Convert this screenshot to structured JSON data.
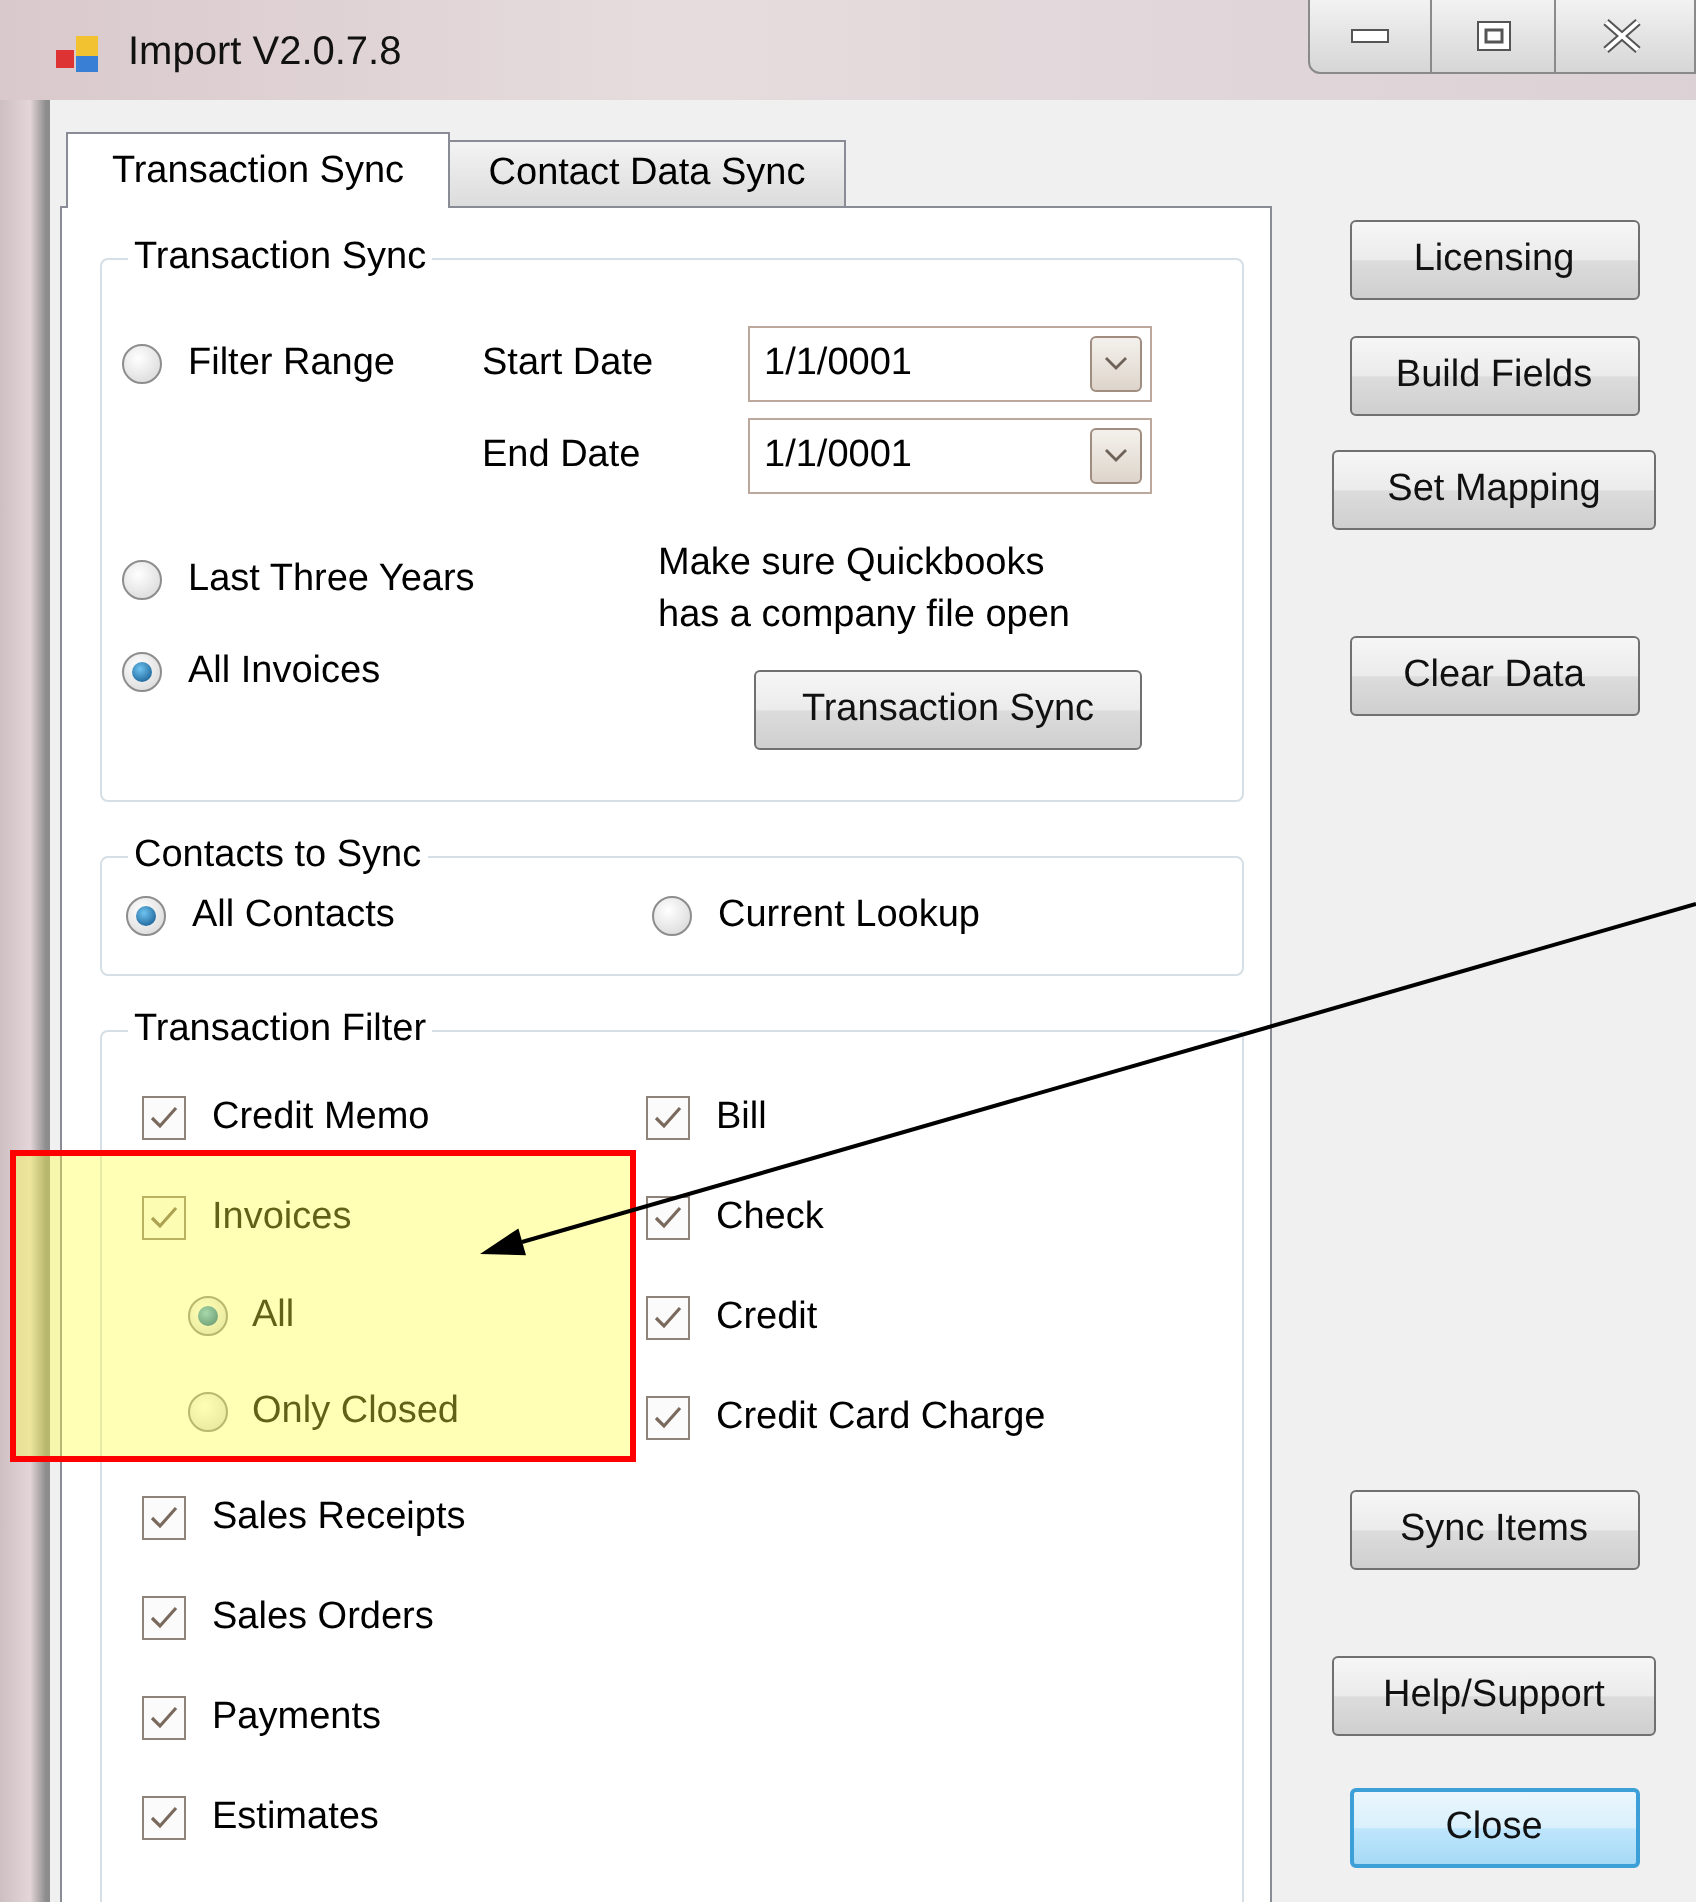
{
  "window": {
    "title": "Import V2.0.7.8"
  },
  "tabs": [
    {
      "label": "Transaction Sync",
      "selected": true
    },
    {
      "label": "Contact Data Sync",
      "selected": false
    }
  ],
  "transaction_sync": {
    "title": "Transaction Sync",
    "range_options": [
      {
        "label": "Filter Range",
        "selected": false
      },
      {
        "label": "Last Three Years",
        "selected": false
      },
      {
        "label": "All Invoices",
        "selected": true
      }
    ],
    "start_date": {
      "label": "Start Date",
      "value": "1/1/0001"
    },
    "end_date": {
      "label": "End Date",
      "value": "1/1/0001"
    },
    "note": "Make sure Quickbooks\nhas a company file open",
    "button": "Transaction Sync"
  },
  "contacts_to_sync": {
    "title": "Contacts to Sync",
    "options": [
      {
        "label": "All Contacts",
        "selected": true
      },
      {
        "label": "Current Lookup",
        "selected": false
      }
    ]
  },
  "transaction_filter": {
    "title": "Transaction Filter",
    "left": [
      {
        "label": "Credit Memo",
        "checked": true
      },
      {
        "label": "Invoices",
        "checked": true,
        "children": [
          {
            "label": "All",
            "selected": true
          },
          {
            "label": "Only Closed",
            "selected": false
          }
        ]
      },
      {
        "label": "Sales Receipts",
        "checked": true
      },
      {
        "label": "Sales Orders",
        "checked": true
      },
      {
        "label": "Payments",
        "checked": true
      },
      {
        "label": "Estimates",
        "checked": true
      }
    ],
    "right": [
      {
        "label": "Bill",
        "checked": true
      },
      {
        "label": "Check",
        "checked": true
      },
      {
        "label": "Credit",
        "checked": true
      },
      {
        "label": "Credit Card Charge",
        "checked": true
      }
    ]
  },
  "buttons": [
    {
      "label": "Licensing",
      "focused": false
    },
    {
      "label": "Build Fields",
      "focused": false
    },
    {
      "label": "Set Mapping",
      "focused": false
    },
    {
      "label": "Clear Data",
      "focused": false
    },
    {
      "label": "Sync Items",
      "focused": false
    },
    {
      "label": "Help/Support",
      "focused": false
    },
    {
      "label": "Close",
      "focused": true
    }
  ]
}
